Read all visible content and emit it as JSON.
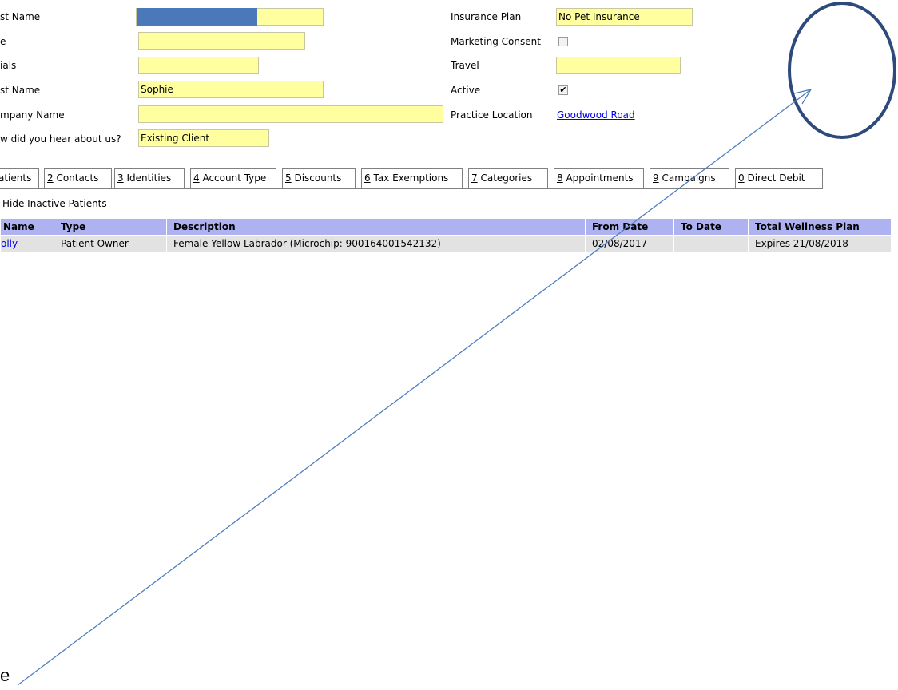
{
  "form": {
    "left": {
      "first_name_label": "st Name",
      "title_label": "e",
      "initials_label": "ials",
      "last_name_label": "st Name",
      "last_name_value": "Sophie",
      "company_label": "mpany Name",
      "hear_label": "w did you hear about us?",
      "hear_value": "Existing Client"
    },
    "right": {
      "insurance_label": "Insurance Plan",
      "insurance_value": "No Pet Insurance",
      "marketing_label": "Marketing Consent",
      "marketing_checked": false,
      "travel_label": "Travel",
      "active_label": "Active",
      "active_mark": "✔",
      "location_label": "Practice Location",
      "location_value": "Goodwood Road"
    }
  },
  "tabs": [
    {
      "key": "",
      "label": "atients"
    },
    {
      "key": "2",
      "label": " Contacts"
    },
    {
      "key": "3",
      "label": " Identities"
    },
    {
      "key": "4",
      "label": " Account Type"
    },
    {
      "key": "5",
      "label": " Discounts"
    },
    {
      "key": "6",
      "label": " Tax Exemptions"
    },
    {
      "key": "7",
      "label": " Categories"
    },
    {
      "key": "8",
      "label": " Appointments"
    },
    {
      "key": "9",
      "label": " Campaigns"
    },
    {
      "key": "0",
      "label": " Direct Debit"
    }
  ],
  "hide_inactive_label": "Hide Inactive Patients",
  "table": {
    "headers": [
      "Name",
      "Type",
      "Description",
      "From Date",
      "To Date",
      "Total Wellness Plan"
    ],
    "rows": [
      [
        "olly",
        "Patient Owner",
        "Female Yellow Labrador (Microchip: 900164001542132)",
        "02/08/2017",
        "",
        "Expires 21/08/2018"
      ]
    ]
  },
  "annotation": {
    "text": "e",
    "color": "#2e4a7d"
  }
}
